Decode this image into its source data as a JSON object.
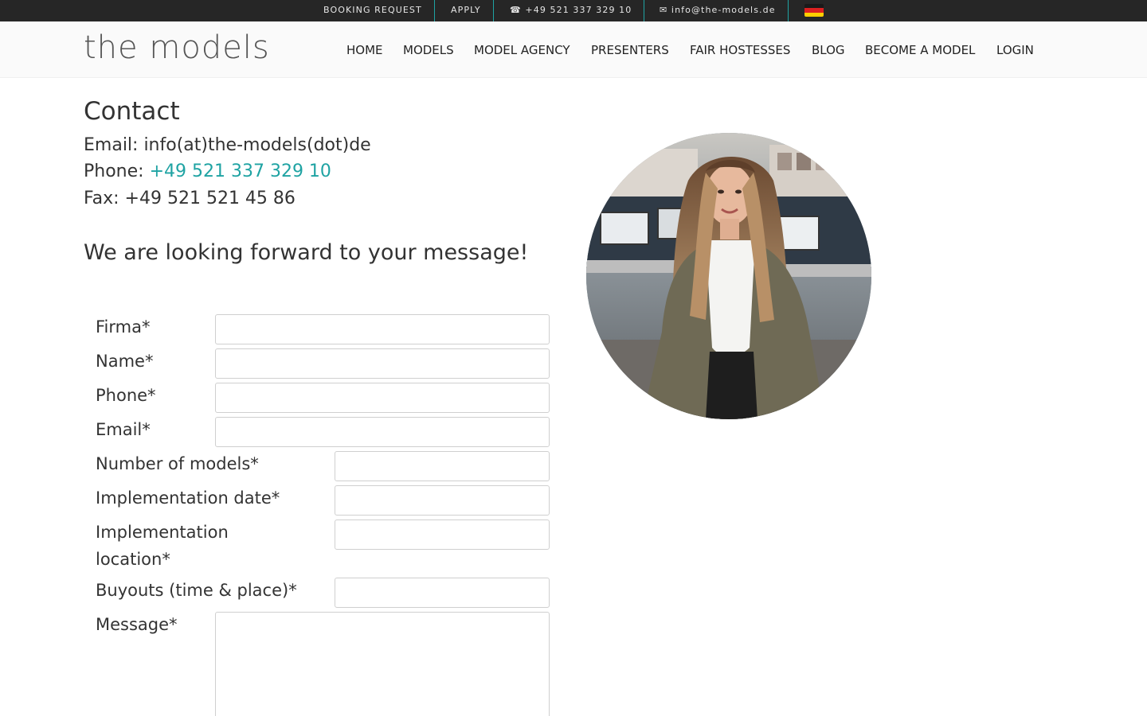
{
  "topbar": {
    "booking_request": "BOOKING REQUEST",
    "apply": "APPLY",
    "phone": "☎ +49 521 337 329 10",
    "email": "✉ info@the-models.de",
    "language_flag": "german-flag-icon",
    "background_color": "#262626",
    "separator_color": "#1fa3a3"
  },
  "header": {
    "logo_text": "the models",
    "nav": [
      "HOME",
      "MODELS",
      "MODEL AGENCY",
      "PRESENTERS",
      "FAIR HOSTESSES",
      "BLOG",
      "BECOME A MODEL",
      "LOGIN"
    ]
  },
  "contact": {
    "title": "Contact",
    "email_line": "Email: info(at)the-models(dot)de",
    "phone_label": "Phone: ",
    "phone_value": "+49 521 337 329 10",
    "fax_line": "Fax: +49 521 521 45 86",
    "accent_color": "#1fa3a3"
  },
  "form": {
    "heading": "We are looking forward to your message!",
    "fields": {
      "firma": "Firma*",
      "name": "Name*",
      "phone": "Phone*",
      "email": "Email*",
      "number_of_models": "Number of models*",
      "implementation_date": "Implementation date*",
      "implementation_location_1": "Implementation",
      "implementation_location_2": "location*",
      "buyouts": "Buyouts (time & place)*",
      "message": "Message*"
    },
    "values": {
      "firma": "",
      "name": "",
      "phone": "",
      "email": "",
      "number_of_models": "",
      "implementation_date": "",
      "implementation_location": "",
      "buyouts": "",
      "message": ""
    }
  },
  "photo": {
    "icon": "contact-person-photo"
  }
}
